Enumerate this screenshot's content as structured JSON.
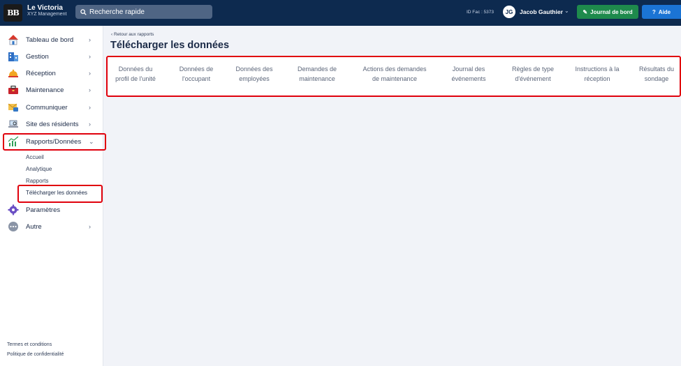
{
  "header": {
    "logo_text": "BB",
    "property_name": "Le Victoria",
    "company": "XYZ Management",
    "search_placeholder": "Recherche rapide",
    "fac_id": "ID Fac : 5373",
    "user_initials": "JG",
    "user_name": "Jacob Gauthier",
    "journal_button": "Journal de bord",
    "help_button": "Aide"
  },
  "sidebar": {
    "items": [
      {
        "label": "Tableau de bord",
        "icon": "house-icon"
      },
      {
        "label": "Gestion",
        "icon": "building-icon"
      },
      {
        "label": "Réception",
        "icon": "bell-icon"
      },
      {
        "label": "Maintenance",
        "icon": "toolbox-icon"
      },
      {
        "label": "Communiquer",
        "icon": "envelope-icon"
      },
      {
        "label": "Site des résidents",
        "icon": "laptop-icon"
      },
      {
        "label": "Rapports/Données",
        "icon": "chart-icon"
      },
      {
        "label": "Paramètres",
        "icon": "gear-icon"
      },
      {
        "label": "Autre",
        "icon": "ellipsis-icon"
      }
    ],
    "sub_items": [
      "Accueil",
      "Analytique",
      "Rapports",
      "Télécharger les données"
    ],
    "footer": [
      "Termes et conditions",
      "Politique de confidentialité"
    ]
  },
  "main": {
    "back_link": "‹ Retour aux rapports",
    "title": "Télécharger les données",
    "tabs": [
      {
        "line1": "Données du",
        "line2": "profil de l'unité"
      },
      {
        "line1": "Données de",
        "line2": "l'occupant"
      },
      {
        "line1": "Données des",
        "line2": "employées"
      },
      {
        "line1": "Demandes de",
        "line2": "maintenance"
      },
      {
        "line1": "Actions des demandes",
        "line2": "de maintenance"
      },
      {
        "line1": "Journal des",
        "line2": "événements"
      },
      {
        "line1": "Règles de type",
        "line2": "d'événement"
      },
      {
        "line1": "Instructions à la",
        "line2": "réception"
      },
      {
        "line1": "Résultats du",
        "line2": "sondage"
      }
    ]
  },
  "colors": {
    "topbar": "#0d2a4f",
    "journal_green": "#1e8a4c",
    "help_blue": "#1b74d4",
    "highlight_red": "#e0000c"
  }
}
